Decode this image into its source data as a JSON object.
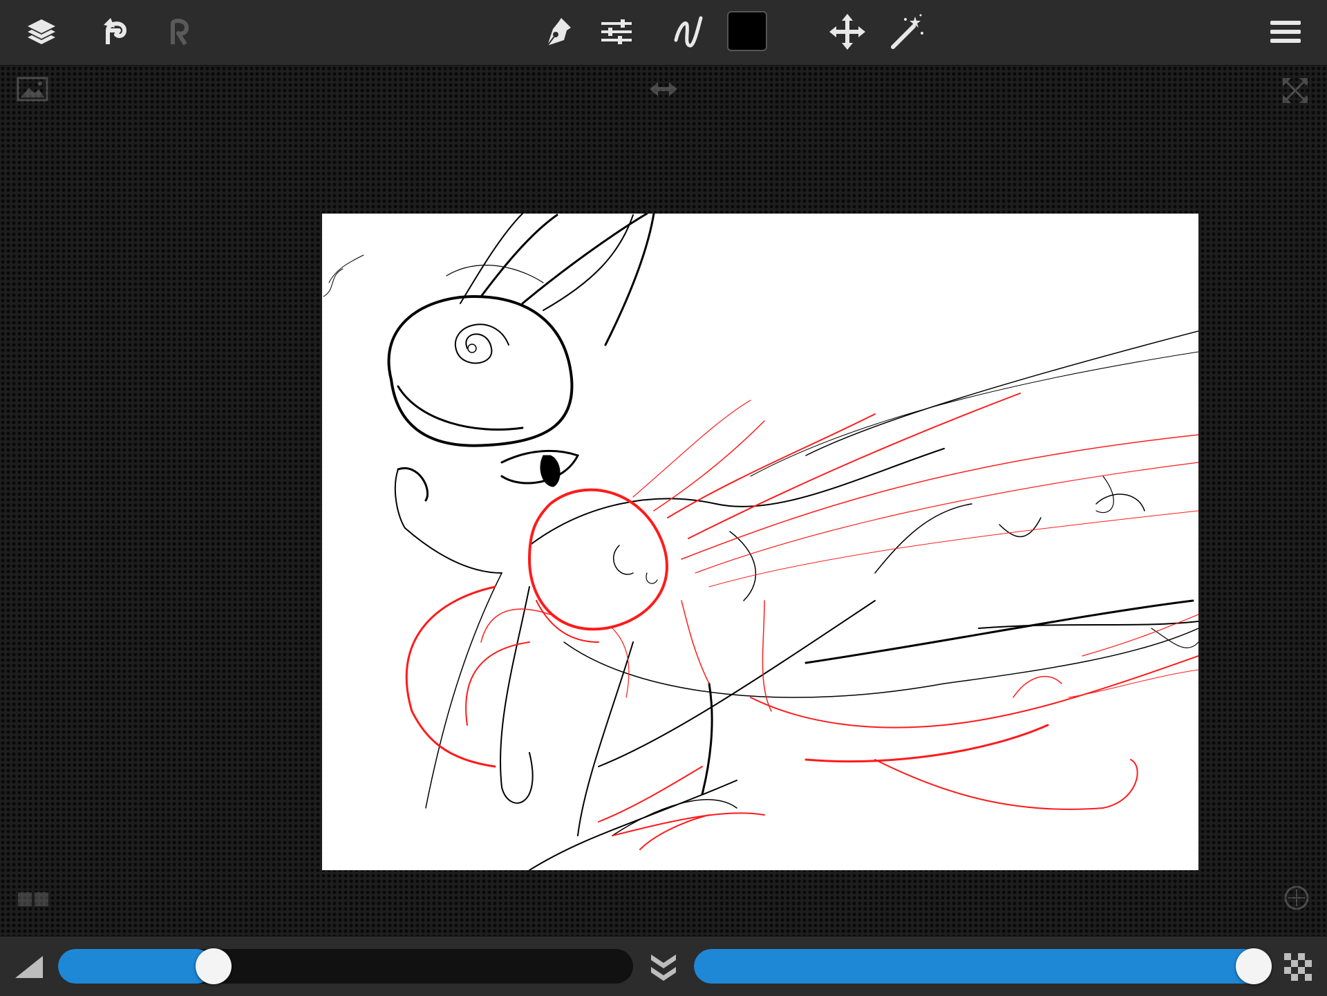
{
  "toolbar": {
    "brush_color": "#000000",
    "redo_enabled": false,
    "icons": [
      "layers-icon",
      "undo-icon",
      "redo-icon",
      "pen-tool-icon",
      "brush-settings-icon",
      "stroke-icon",
      "move-icon",
      "magic-wand-icon",
      "menu-icon"
    ]
  },
  "workspace": {
    "corner_icons": [
      "reference-image-icon",
      "flip-horizontal-icon",
      "fullscreen-icon",
      "layer-thumbnails-icon",
      "texture-icon"
    ]
  },
  "canvas": {
    "background": "#ffffff",
    "sketch_colors": [
      "#000000",
      "#ff1a1a"
    ]
  },
  "bottombar": {
    "size_slider": {
      "icon": "brush-size-icon",
      "value": 0.27
    },
    "opacity_slider": {
      "icon": "opacity-checker-icon",
      "value": 1.0
    },
    "center_icon": "collapse-down-icon",
    "accent": "#1e88d6"
  }
}
